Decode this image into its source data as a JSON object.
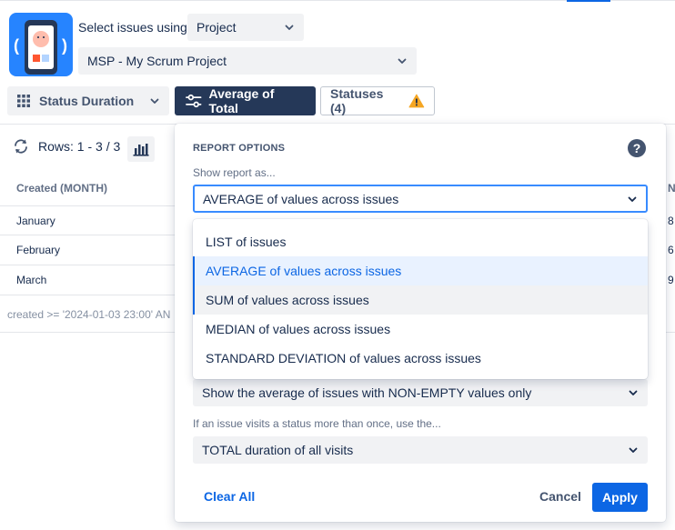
{
  "header": {
    "select_label": "Select issues using",
    "source_type": "Project",
    "project_name": "MSP - My Scrum Project"
  },
  "toolbar": {
    "status_duration_label": "Status Duration",
    "average_label": "Average of Total",
    "statuses_label": "Statuses (4)"
  },
  "table": {
    "rows_label": "Rows: 1 - 3 / 3",
    "column_header": "Created (MONTH)",
    "rows": [
      "January",
      "February",
      "March"
    ],
    "right_header_fragment": "N",
    "right_values_fragments": [
      "8",
      "6",
      "9"
    ],
    "filter_text": "created >= '2024-01-03 23:00' AN"
  },
  "panel": {
    "title": "REPORT OPTIONS",
    "show_as_label": "Show report as...",
    "show_as_value": "AVERAGE of values across issues",
    "options": [
      "LIST of issues",
      "AVERAGE of values across issues",
      "SUM of values across issues",
      "MEDIAN of values across issues",
      "STANDARD DEVIATION of values across issues"
    ],
    "selected_index": 1,
    "nonempty_value": "Show the average of issues with NON-EMPTY values only",
    "visits_label": "If an issue visits a status more than once, use the...",
    "visits_value": "TOTAL duration of all visits",
    "clear_label": "Clear All",
    "cancel_label": "Cancel",
    "apply_label": "Apply"
  },
  "colors": {
    "primary": "#0C66E4",
    "dark_button": "#253858",
    "warning": "#F5A623"
  }
}
